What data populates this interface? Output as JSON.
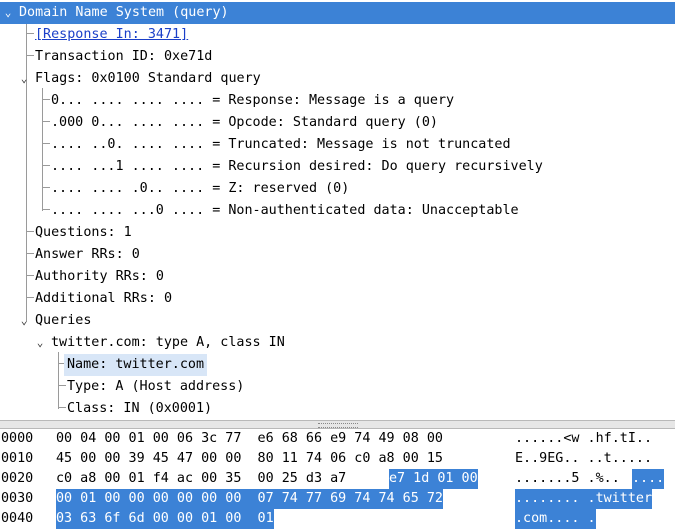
{
  "tree": {
    "root": "Domain Name System (query)",
    "response_in": "[Response In: 3471]",
    "transaction_id": "Transaction ID: 0xe71d",
    "flags": "Flags: 0x0100 Standard query",
    "flag_items": [
      "0... .... .... .... = Response: Message is a query",
      ".000 0... .... .... = Opcode: Standard query (0)",
      ".... ..0. .... .... = Truncated: Message is not truncated",
      ".... ...1 .... .... = Recursion desired: Do query recursively",
      ".... .... .0.. .... = Z: reserved (0)",
      ".... .... ...0 .... = Non-authenticated data: Unacceptable"
    ],
    "questions": "Questions: 1",
    "answer_rrs": "Answer RRs: 0",
    "authority_rrs": "Authority RRs: 0",
    "additional_rrs": "Additional RRs: 0",
    "queries": "Queries",
    "query": "twitter.com: type A, class IN",
    "query_items": [
      "Name: twitter.com",
      "Type: A (Host address)",
      "Class: IN (0x0001)"
    ]
  },
  "hex": [
    {
      "offset": "0000",
      "bytes": [
        "00 04 00 01 00 06 3c 77  e6 68 66 e9 74 49 08 00"
      ],
      "ascii": [
        "......<w .hf.tI.."
      ]
    },
    {
      "offset": "0010",
      "bytes": [
        "45 00 00 39 45 47 00 00  80 11 74 06 c0 a8 00 15"
      ],
      "ascii": [
        "E..9EG.. ..t....."
      ]
    },
    {
      "offset": "0020",
      "bytes": [
        "c0 a8 00 01 f4 ac 00 35  00 25 d3 a7",
        "e7 1d 01 00"
      ],
      "ascii": [
        ".......5 .%..",
        "...."
      ]
    },
    {
      "offset": "0030",
      "bytes": [
        "",
        "00 01 00 00 00 00 00 00  07 74 77 69 74 74 65 72"
      ],
      "ascii": [
        "",
        "........ .twitter"
      ]
    },
    {
      "offset": "0040",
      "bytes": [
        "",
        "03 63 6f 6d 00 00 01 00  01"
      ],
      "ascii": [
        "",
        ".com.... ."
      ]
    }
  ],
  "colors": {
    "selection": "#3c82d6",
    "highlight": "#d8e6f7",
    "link": "#1a3fc8"
  }
}
